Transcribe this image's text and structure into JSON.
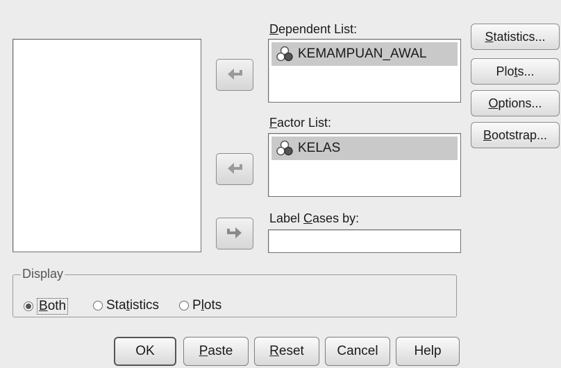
{
  "dependent_list": {
    "label_pre": "",
    "label_ul": "D",
    "label_post": "ependent List:",
    "items": [
      {
        "name": "KEMAMPUAN_AWAL",
        "icon": "nominal-variable-icon"
      }
    ]
  },
  "factor_list": {
    "label_ul": "F",
    "label_post": "actor List:",
    "items": [
      {
        "name": "KELAS",
        "icon": "nominal-variable-icon"
      }
    ]
  },
  "label_cases": {
    "label_pre": "Label ",
    "label_ul": "C",
    "label_post": "ases by:",
    "value": ""
  },
  "side_buttons": {
    "statistics": {
      "ul": "S",
      "rest": "tatistics..."
    },
    "plots": {
      "pre": "Plo",
      "ul": "t",
      "rest": "s..."
    },
    "options": {
      "ul": "O",
      "rest": "ptions..."
    },
    "bootstrap": {
      "ul": "B",
      "rest": "ootstrap..."
    }
  },
  "display": {
    "legend": "Display",
    "options": [
      {
        "pre": "",
        "ul": "B",
        "rest": "oth",
        "selected": true
      },
      {
        "pre": "Sta",
        "ul": "t",
        "rest": "istics",
        "selected": false
      },
      {
        "pre": "P",
        "ul": "l",
        "rest": "ots",
        "selected": false
      }
    ]
  },
  "bottom_buttons": {
    "ok": "OK",
    "paste": {
      "ul": "P",
      "rest": "aste"
    },
    "reset": {
      "ul": "R",
      "rest": "eset"
    },
    "cancel": "Cancel",
    "help": "Help"
  },
  "colors": {
    "selection": "#c9c9c9",
    "arrow": "#8a8a8a",
    "background": "#ececec"
  }
}
